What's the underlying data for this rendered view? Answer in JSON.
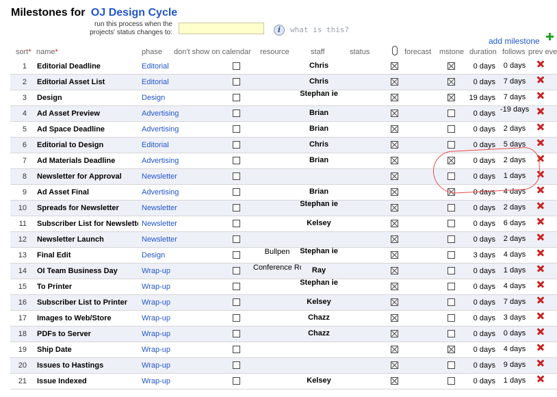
{
  "header": {
    "title_prefix": "Milestones for",
    "project_name": "OJ Design Cycle",
    "run_label": "run this process when the projects' status changes to:",
    "status_value": "",
    "info_icon": "i",
    "what_is_this": "what is this?",
    "add_milestone": "add milestone"
  },
  "columns": {
    "sort": "sort",
    "name": "name",
    "phase": "phase",
    "calendar": "don't show on calendar",
    "resource": "resource",
    "staff": "staff",
    "status": "status",
    "forecast": "forecast",
    "mstone": "mstone",
    "duration": "duration",
    "follows": "follows",
    "prev": "prev eve"
  },
  "rows": [
    {
      "sort": "1",
      "name": "Editorial Deadline",
      "phase": "Editorial",
      "resource": "",
      "staff": "Chris",
      "attach": true,
      "mstone": true,
      "duration": "0 days",
      "follows": "0 days"
    },
    {
      "sort": "2",
      "name": "Editorial Asset List",
      "phase": "Editorial",
      "resource": "",
      "staff": "Chris",
      "attach": true,
      "mstone": true,
      "duration": "0 days",
      "follows": "7 days"
    },
    {
      "sort": "3",
      "name": "Design",
      "phase": "Design",
      "resource": "",
      "staff": "Stephan ie",
      "attach": true,
      "mstone": true,
      "duration": "19 days",
      "follows": "7 days"
    },
    {
      "sort": "4",
      "name": "Ad Asset Preview",
      "phase": "Advertising",
      "resource": "",
      "staff": "Brian",
      "attach": true,
      "mstone": false,
      "duration": "0 days",
      "follows": "-19 days"
    },
    {
      "sort": "5",
      "name": "Ad Space Deadline",
      "phase": "Advertising",
      "resource": "",
      "staff": "Brian",
      "attach": true,
      "mstone": false,
      "duration": "0 days",
      "follows": "2 days"
    },
    {
      "sort": "6",
      "name": "Editorial to Design",
      "phase": "Editorial",
      "resource": "",
      "staff": "Chris",
      "attach": true,
      "mstone": false,
      "duration": "0 days",
      "follows": "5 days"
    },
    {
      "sort": "7",
      "name": "Ad Materials Deadline",
      "phase": "Advertising",
      "resource": "",
      "staff": "Brian",
      "attach": true,
      "mstone": true,
      "duration": "0 days",
      "follows": "2 days"
    },
    {
      "sort": "8",
      "name": "Newsletter for Approval",
      "phase": "Newsletter",
      "resource": "",
      "staff": "",
      "attach": true,
      "mstone": false,
      "duration": "0 days",
      "follows": "1 days"
    },
    {
      "sort": "9",
      "name": "Ad Asset Final",
      "phase": "Advertising",
      "resource": "",
      "staff": "Brian",
      "attach": true,
      "mstone": true,
      "duration": "0 days",
      "follows": "4 days"
    },
    {
      "sort": "10",
      "name": "Spreads for Newsletter",
      "phase": "Newsletter",
      "resource": "",
      "staff": "Stephan ie",
      "attach": true,
      "mstone": false,
      "duration": "0 days",
      "follows": "2 days"
    },
    {
      "sort": "11",
      "name": "Subscriber List for Newsletter",
      "phase": "Newsletter",
      "resource": "",
      "staff": "Kelsey",
      "attach": true,
      "mstone": false,
      "duration": "0 days",
      "follows": "6 days"
    },
    {
      "sort": "12",
      "name": "Newsletter Launch",
      "phase": "Newsletter",
      "resource": "",
      "staff": "",
      "attach": true,
      "mstone": false,
      "duration": "0 days",
      "follows": "2 days"
    },
    {
      "sort": "13",
      "name": "Final Edit",
      "phase": "Design",
      "resource": "Bullpen",
      "staff": "Stephan ie",
      "attach": true,
      "mstone": false,
      "duration": "3 days",
      "follows": "4 days"
    },
    {
      "sort": "14",
      "name": "OI Team Business Day",
      "phase": "Wrap-up",
      "resource": "Conference Room",
      "staff": "Ray",
      "attach": true,
      "mstone": false,
      "duration": "0 days",
      "follows": "1 days"
    },
    {
      "sort": "15",
      "name": "To Printer",
      "phase": "Wrap-up",
      "resource": "",
      "staff": "Stephan ie",
      "attach": true,
      "mstone": false,
      "duration": "0 days",
      "follows": "4 days"
    },
    {
      "sort": "16",
      "name": "Subscriber List to Printer",
      "phase": "Wrap-up",
      "resource": "",
      "staff": "Kelsey",
      "attach": true,
      "mstone": false,
      "duration": "0 days",
      "follows": "7 days"
    },
    {
      "sort": "17",
      "name": "Images to Web/Store",
      "phase": "Wrap-up",
      "resource": "",
      "staff": "Chazz",
      "attach": true,
      "mstone": false,
      "duration": "0 days",
      "follows": "3 days"
    },
    {
      "sort": "18",
      "name": "PDFs to Server",
      "phase": "Wrap-up",
      "resource": "",
      "staff": "Chazz",
      "attach": true,
      "mstone": false,
      "duration": "0 days",
      "follows": "0 days"
    },
    {
      "sort": "19",
      "name": "Ship Date",
      "phase": "Wrap-up",
      "resource": "",
      "staff": "",
      "attach": true,
      "mstone": true,
      "duration": "0 days",
      "follows": "4 days"
    },
    {
      "sort": "20",
      "name": "Issues to Hastings",
      "phase": "Wrap-up",
      "resource": "",
      "staff": "",
      "attach": true,
      "mstone": false,
      "duration": "0 days",
      "follows": "9 days"
    },
    {
      "sort": "21",
      "name": "Issue Indexed",
      "phase": "Wrap-up",
      "resource": "",
      "staff": "Kelsey",
      "attach": true,
      "mstone": false,
      "duration": "0 days",
      "follows": "1 days"
    }
  ],
  "colors": {
    "link": "#2255cc",
    "row_alt": "#eef0f8",
    "delete": "#cc2222",
    "add": "#22a322",
    "highlight": "#e84a4a"
  }
}
